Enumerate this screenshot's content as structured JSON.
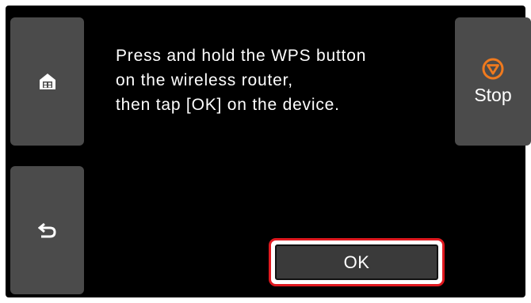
{
  "dialog": {
    "message": "Press and hold the WPS button\non the wireless router,\nthen tap [OK] on the device."
  },
  "buttons": {
    "home_icon": "home-icon",
    "back_icon": "back-arrow-icon",
    "stop_icon": "stop-icon",
    "stop_label": "Stop",
    "ok_label": "OK"
  },
  "colors": {
    "background": "#000000",
    "button": "#4b4b4b",
    "stop_accent": "#f07a1e",
    "highlight": "#e0191f"
  }
}
